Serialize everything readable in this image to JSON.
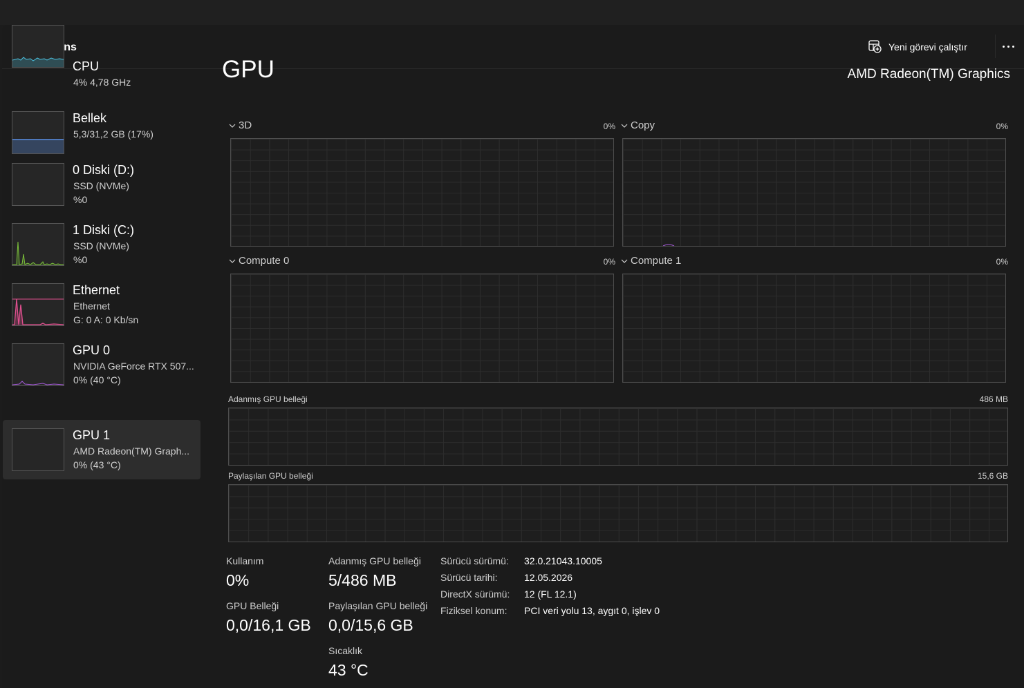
{
  "header": {
    "title": "Performans",
    "run_new_task": "Yeni görevi çalıştır"
  },
  "sidebar": {
    "items": [
      {
        "name": "CPU",
        "sub1": "4% 4,78 GHz",
        "sub2": ""
      },
      {
        "name": "Bellek",
        "sub1": "5,3/31,2 GB (17%)",
        "sub2": ""
      },
      {
        "name": "0 Diski (D:)",
        "sub1": "SSD (NVMe)",
        "sub2": "%0"
      },
      {
        "name": "1 Diski (C:)",
        "sub1": "SSD (NVMe)",
        "sub2": "%0"
      },
      {
        "name": "Ethernet",
        "sub1": "Ethernet",
        "sub2": "G: 0 A: 0 Kb/sn"
      },
      {
        "name": "GPU 0",
        "sub1": "NVIDIA GeForce RTX 507...",
        "sub2": "0% (40 °C)"
      },
      {
        "name": "GPU 1",
        "sub1": "AMD Radeon(TM) Graph...",
        "sub2": "0% (43 °C)"
      }
    ],
    "selected": "GPU 1",
    "colors": {
      "cpu": "#4cc2e0",
      "memory": "#5a8fe6",
      "disk": "#7bc03a",
      "ethernet": "#e0508f",
      "gpu": "#a45ad8"
    }
  },
  "main": {
    "title": "GPU",
    "device": "AMD Radeon(TM) Graphics",
    "engines": [
      {
        "label": "3D",
        "pct": "0%"
      },
      {
        "label": "Copy",
        "pct": "0%"
      },
      {
        "label": "Compute 0",
        "pct": "0%"
      },
      {
        "label": "Compute 1",
        "pct": "0%"
      }
    ],
    "dedicated_memory": {
      "label": "Adanmış GPU belleği",
      "max": "486 MB"
    },
    "shared_memory": {
      "label": "Paylaşılan GPU belleği",
      "max": "15,6 GB"
    }
  },
  "stats": {
    "usage_label": "Kullanım",
    "usage_value": "0%",
    "gpu_mem_label": "GPU Belleği",
    "gpu_mem_value": "0,0/16,1 GB",
    "dedicated_label": "Adanmış GPU belleği",
    "dedicated_value": "5/486 MB",
    "shared_label": "Paylaşılan GPU belleği",
    "shared_value": "0,0/15,6 GB",
    "temp_label": "Sıcaklık",
    "temp_value": "43 °C"
  },
  "details": [
    {
      "key": "Sürücü sürümü:",
      "value": "32.0.21043.10005"
    },
    {
      "key": "Sürücü tarihi:",
      "value": "12.05.2026"
    },
    {
      "key": "DirectX sürümü:",
      "value": "12 (FL 12.1)"
    },
    {
      "key": "Fiziksel konum:",
      "value": "PCI veri yolu 13, aygıt 0, işlev 0"
    }
  ]
}
